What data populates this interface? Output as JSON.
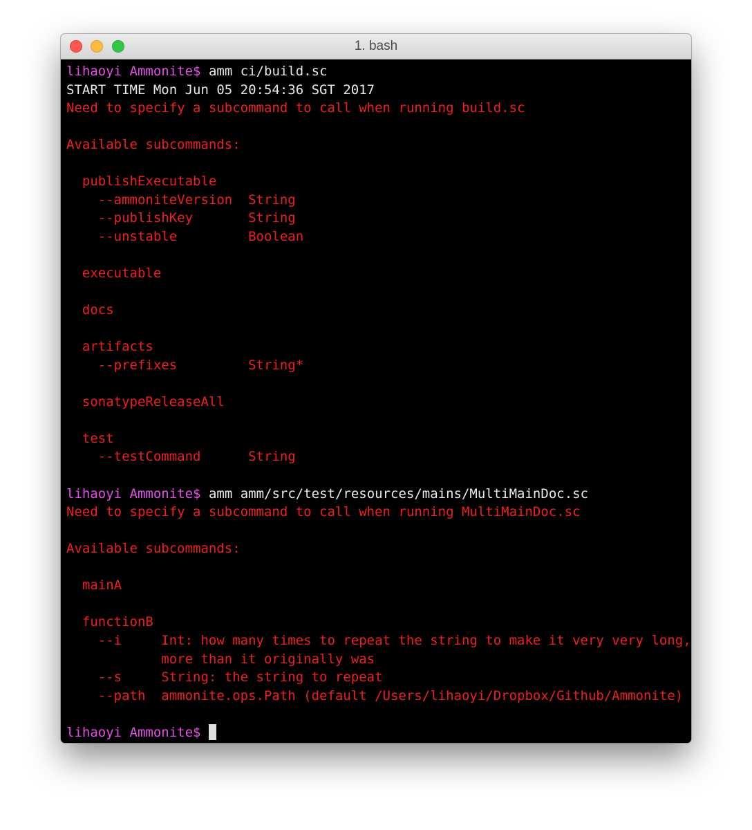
{
  "window": {
    "title": "1. bash"
  },
  "colors": {
    "prompt": "#e24fe6",
    "output": "#ee1f1f",
    "text": "#e8e8e8",
    "background": "#000000"
  },
  "terminal": {
    "lines": [
      {
        "type": "prompt",
        "user": "lihaoyi",
        "cwd": "Ammonite$",
        "command": "amm ci/build.sc"
      },
      {
        "type": "white",
        "text": "START TIME Mon Jun 05 20:54:36 SGT 2017"
      },
      {
        "type": "red",
        "text": "Need to specify a subcommand to call when running build.sc"
      },
      {
        "type": "blank",
        "text": ""
      },
      {
        "type": "red",
        "text": "Available subcommands:"
      },
      {
        "type": "blank",
        "text": ""
      },
      {
        "type": "red",
        "text": "  publishExecutable"
      },
      {
        "type": "red",
        "text": "    --ammoniteVersion  String"
      },
      {
        "type": "red",
        "text": "    --publishKey       String"
      },
      {
        "type": "red",
        "text": "    --unstable         Boolean"
      },
      {
        "type": "blank",
        "text": ""
      },
      {
        "type": "red",
        "text": "  executable"
      },
      {
        "type": "blank",
        "text": ""
      },
      {
        "type": "red",
        "text": "  docs"
      },
      {
        "type": "blank",
        "text": ""
      },
      {
        "type": "red",
        "text": "  artifacts"
      },
      {
        "type": "red",
        "text": "    --prefixes         String*"
      },
      {
        "type": "blank",
        "text": ""
      },
      {
        "type": "red",
        "text": "  sonatypeReleaseAll"
      },
      {
        "type": "blank",
        "text": ""
      },
      {
        "type": "red",
        "text": "  test"
      },
      {
        "type": "red",
        "text": "    --testCommand      String"
      },
      {
        "type": "blank",
        "text": ""
      },
      {
        "type": "prompt",
        "user": "lihaoyi",
        "cwd": "Ammonite$",
        "command": "amm amm/src/test/resources/mains/MultiMainDoc.sc"
      },
      {
        "type": "red",
        "text": "Need to specify a subcommand to call when running MultiMainDoc.sc"
      },
      {
        "type": "blank",
        "text": ""
      },
      {
        "type": "red",
        "text": "Available subcommands:"
      },
      {
        "type": "blank",
        "text": ""
      },
      {
        "type": "red",
        "text": "  mainA"
      },
      {
        "type": "blank",
        "text": ""
      },
      {
        "type": "red",
        "text": "  functionB"
      },
      {
        "type": "red",
        "text": "    --i     Int: how many times to repeat the string to make it very very long,"
      },
      {
        "type": "red",
        "text": "            more than it originally was"
      },
      {
        "type": "red",
        "text": "    --s     String: the string to repeat"
      },
      {
        "type": "red",
        "text": "    --path  ammonite.ops.Path (default /Users/lihaoyi/Dropbox/Github/Ammonite)"
      },
      {
        "type": "blank",
        "text": ""
      },
      {
        "type": "prompt",
        "user": "lihaoyi",
        "cwd": "Ammonite$",
        "command": "",
        "cursor": true
      }
    ]
  }
}
